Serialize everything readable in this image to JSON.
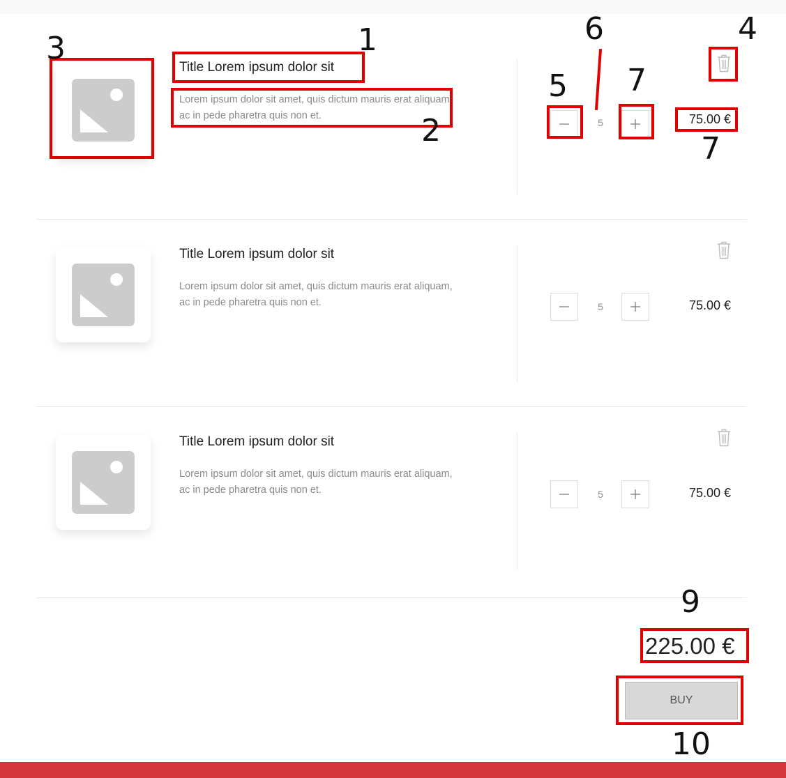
{
  "cart": {
    "items": [
      {
        "title": "Title Lorem ipsum dolor sit",
        "description": "Lorem ipsum dolor sit amet, quis dictum mauris erat aliquam, ac in pede pharetra quis non et.",
        "quantity": "5",
        "price": "75.00 €"
      },
      {
        "title": "Title Lorem ipsum dolor sit",
        "description": "Lorem ipsum dolor sit amet, quis dictum mauris erat aliquam, ac in pede pharetra quis non et.",
        "quantity": "5",
        "price": "75.00 €"
      },
      {
        "title": "Title Lorem ipsum dolor sit",
        "description": "Lorem ipsum dolor sit amet, quis dictum mauris erat aliquam, ac in pede pharetra quis non et.",
        "quantity": "5",
        "price": "75.00 €"
      }
    ],
    "total": "225.00 €",
    "buy_label": "BUY"
  },
  "annotations": {
    "n1": "1",
    "n2": "2",
    "n3": "3",
    "n4": "4",
    "n5": "5",
    "n6": "6",
    "n7a": "7",
    "n7b": "7",
    "n9": "9",
    "n10": "10"
  },
  "icons": {
    "thumbnail": "image-placeholder-icon",
    "delete": "trash-icon",
    "decrement": "minus-icon",
    "increment": "plus-icon"
  },
  "colors": {
    "accent_bar": "#d3353b",
    "annotation": "#e00000",
    "placeholder": "#cccccc"
  }
}
